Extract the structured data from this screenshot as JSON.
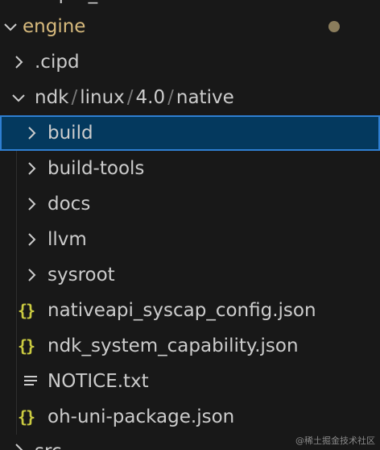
{
  "tree": {
    "top_partial": "ohpm_s",
    "engine": {
      "label": "engine",
      "modified_color": "#8b7d5c"
    },
    "cipd": {
      "label": ".cipd"
    },
    "path": {
      "parts": [
        "ndk",
        "linux",
        "4.0",
        "native"
      ],
      "separator": "/"
    },
    "items": [
      {
        "label": "build",
        "type": "folder",
        "selected": true
      },
      {
        "label": "build-tools",
        "type": "folder"
      },
      {
        "label": "docs",
        "type": "folder"
      },
      {
        "label": "llvm",
        "type": "folder"
      },
      {
        "label": "sysroot",
        "type": "folder"
      },
      {
        "label": "nativeapi_syscap_config.json",
        "type": "json",
        "icon_text": "{}"
      },
      {
        "label": "ndk_system_capability.json",
        "type": "json",
        "icon_text": "{}"
      },
      {
        "label": "NOTICE.txt",
        "type": "text"
      },
      {
        "label": "oh-uni-package.json",
        "type": "json",
        "icon_text": "{}"
      }
    ],
    "bottom_partial": "src"
  },
  "colors": {
    "background": "#181818",
    "selection": "#04395e",
    "selection_border": "#2f7fd2",
    "json_icon": "#cbcb41",
    "folder_modified": "#d7ba7d"
  },
  "watermark": "@稀土掘金技术社区"
}
